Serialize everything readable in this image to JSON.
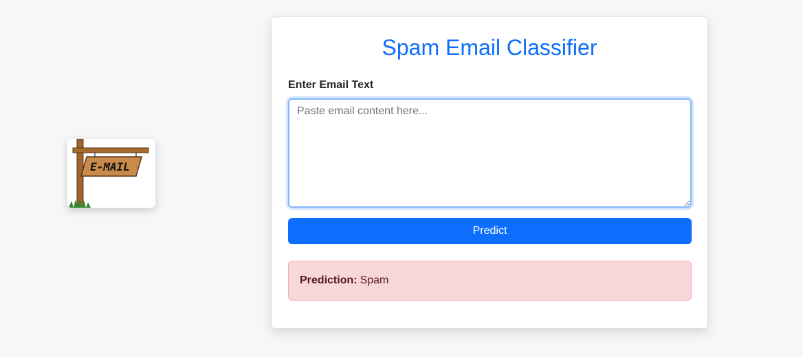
{
  "logo": {
    "sign_text": "E-MAIL",
    "icon": "email-signpost-icon"
  },
  "card": {
    "title": "Spam Email Classifier",
    "field_label": "Enter Email Text",
    "textarea_placeholder": "Paste email content here...",
    "textarea_value": "",
    "predict_label": "Predict",
    "result": {
      "label": "Prediction:",
      "value": "Spam"
    }
  },
  "colors": {
    "accent": "#0d6efd",
    "alert_bg": "#f8d7da",
    "alert_text": "#58151c"
  }
}
